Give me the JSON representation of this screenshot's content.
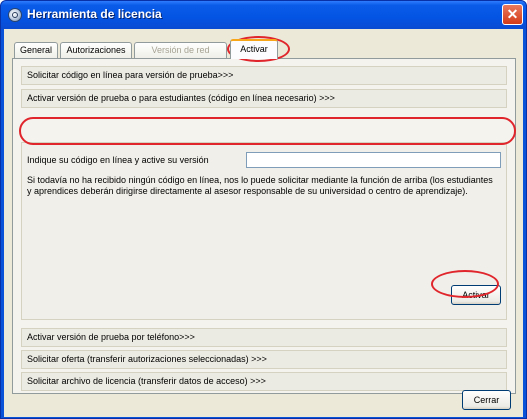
{
  "window": {
    "title": "Herramienta de licencia",
    "close_glyph": "✕",
    "app_icon": "license-tool-icon"
  },
  "tabs": [
    {
      "label": "General",
      "state": "normal"
    },
    {
      "label": "Autorizaciones",
      "state": "normal"
    },
    {
      "label": "Versión de red",
      "state": "disabled"
    },
    {
      "label": "Activar",
      "state": "selected"
    }
  ],
  "sections": {
    "trial_code_online": "Solicitar código en línea para versión de prueba>>>",
    "activate_trial_students": "Activar versión de prueba o para estudiantes (código en línea necesario) >>>",
    "activate_phone": "Activar versión de prueba por teléfono>>>",
    "request_offer": "Solicitar oferta (transferir autorizaciones seleccionadas) >>>",
    "request_license_file": "Solicitar archivo de licencia (transferir datos de acceso) >>>"
  },
  "activation": {
    "code_label": "Indique su código en línea y active su versión",
    "code_value": "",
    "info_text": "Si todavía no ha recibido ningún código en línea, nos lo puede solicitar mediante la función de arriba (los estudiantes y aprendices deberán dirigirse directamente al asesor responsable de su universidad o centro de aprendizaje).",
    "activate_label": "Activar"
  },
  "footer": {
    "close_label": "Cerrar"
  },
  "colors": {
    "title_bar": "#0454e3",
    "highlight_annotation": "#e0262c",
    "dialog_background": "#ece9d8"
  }
}
